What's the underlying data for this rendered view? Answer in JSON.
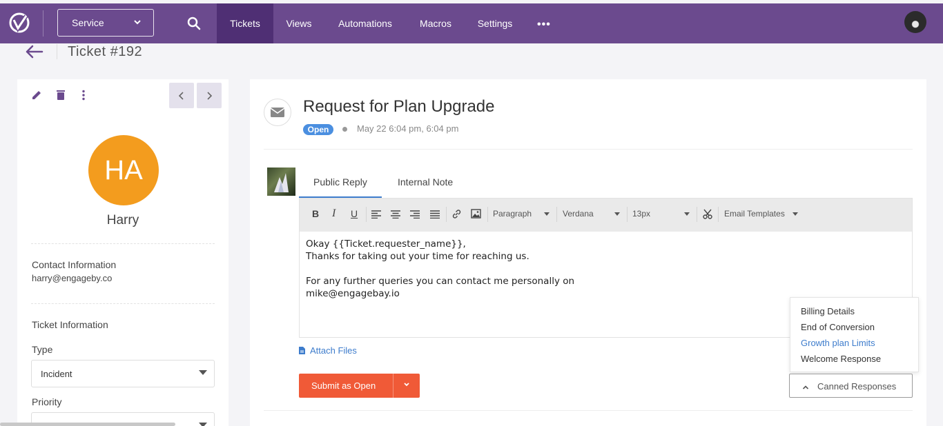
{
  "nav": {
    "service_label": "Service",
    "items": [
      {
        "label": "Tickets",
        "active": true
      },
      {
        "label": "Views",
        "active": false
      },
      {
        "label": "Automations",
        "active": false
      },
      {
        "label": "Macros",
        "active": false
      },
      {
        "label": "Settings",
        "active": false
      }
    ],
    "more_label": "•••",
    "colors": {
      "bar": "#6b4a8e",
      "active": "#4f2f74"
    }
  },
  "breadcrumb": {
    "title": "Ticket #192"
  },
  "sidebar": {
    "avatar_initials": "HA",
    "avatar_color": "#f39c1e",
    "name": "Harry",
    "contact_label": "Contact Information",
    "contact_email": "harry@engageby.co",
    "ticket_info_label": "Ticket Information",
    "type_label": "Type",
    "type_value": "Incident",
    "priority_label": "Priority"
  },
  "ticket": {
    "subject": "Request for Plan Upgrade",
    "status": "Open",
    "status_color": "#4b8fe0",
    "date": "May 22 6:04 pm, 6:04 pm"
  },
  "reply": {
    "tabs": [
      {
        "label": "Public Reply",
        "active": true
      },
      {
        "label": "Internal Note",
        "active": false
      }
    ],
    "toolbar": {
      "bold": "B",
      "italic": "I",
      "underline": "U",
      "paragraph": "Paragraph",
      "font": "Verdana",
      "size": "13px",
      "templates": "Email Templates"
    },
    "body_lines": [
      "Okay {{Ticket.requester_name}},",
      "Thanks for taking out your time for reaching us.",
      "",
      "For any further queries you can contact me personally on",
      "mike@engagebay.io"
    ],
    "attach_label": "Attach Files",
    "submit_label": "Submit as Open",
    "submit_color": "#f05a37"
  },
  "canned": {
    "button_label": "Canned Responses",
    "items": [
      {
        "label": "Billing Details",
        "active": false
      },
      {
        "label": "End of Conversion",
        "active": false
      },
      {
        "label": "Growth plan Limits",
        "active": true
      },
      {
        "label": "Welcome Response",
        "active": false
      }
    ]
  }
}
